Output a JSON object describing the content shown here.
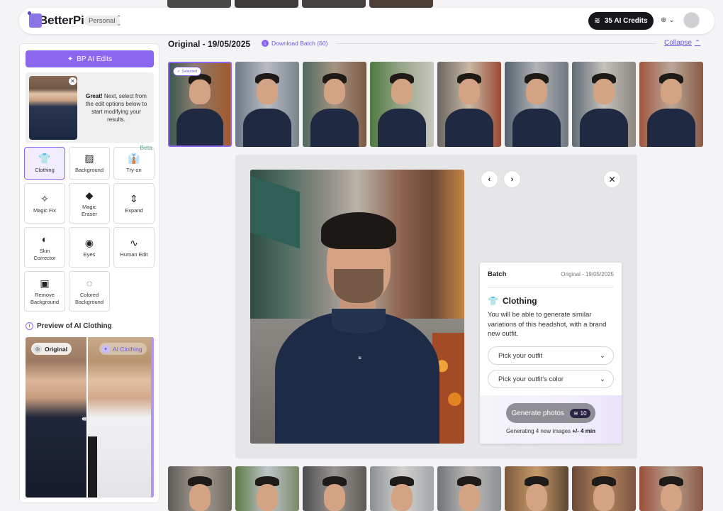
{
  "header": {
    "logo_text": "BetterPic",
    "plan": "Personal",
    "credits_label": "35 AI Credits",
    "language_icon": "globe-icon"
  },
  "sidebar": {
    "ai_edits_label": "BP AI Edits",
    "intro": {
      "bold": "Great!",
      "text": " Next, select from the edit options below to start modifying your results."
    },
    "tools": [
      {
        "label": "Clothing",
        "icon": "shirt-icon",
        "glyph": "👕",
        "active": true
      },
      {
        "label": "Background",
        "icon": "background-icon",
        "glyph": "▨"
      },
      {
        "label": "Try-on",
        "icon": "tryon-icon",
        "glyph": "👔",
        "badge": "Beta"
      },
      {
        "label": "Magic Fix",
        "icon": "magic-wand-icon",
        "glyph": "✧"
      },
      {
        "label": "Magic Eraser",
        "icon": "eraser-icon",
        "glyph": "◆"
      },
      {
        "label": "Expand",
        "icon": "expand-icon",
        "glyph": "⇕"
      },
      {
        "label": "Skin Corrector",
        "icon": "skin-icon",
        "glyph": "◐"
      },
      {
        "label": "Eyes",
        "icon": "eye-icon",
        "glyph": "◉"
      },
      {
        "label": "Human Edit",
        "icon": "human-edit-icon",
        "glyph": "∿"
      },
      {
        "label": "Remove Background",
        "icon": "remove-bg-icon",
        "glyph": "▣"
      },
      {
        "label": "Colored Background",
        "icon": "colored-bg-icon",
        "glyph": "◌"
      }
    ],
    "preview_title": "Preview of AI Clothing",
    "compare_original": "Original",
    "compare_ai": "AI Clothing"
  },
  "batch": {
    "title": "Original - 19/05/2025",
    "download_label": "Download Batch (60)",
    "collapse_label": "Collapse",
    "selected_badge": "Selected"
  },
  "panel": {
    "batch_label": "Batch",
    "batch_date": "Original - 19/05/2025",
    "tool_name": "Clothing",
    "description": "You will be able to generate similar variations of this headshot, with a brand new outfit.",
    "outfit_placeholder": "Pick your outfit",
    "color_placeholder": "Pick your outfit's color",
    "generate_label": "Generate photos",
    "generate_cost": "10",
    "note_prefix": "Generating 4 new images ",
    "note_time": "+/- 4 min"
  },
  "colors": {
    "accent": "#8b66ee",
    "dark": "#17171b"
  }
}
